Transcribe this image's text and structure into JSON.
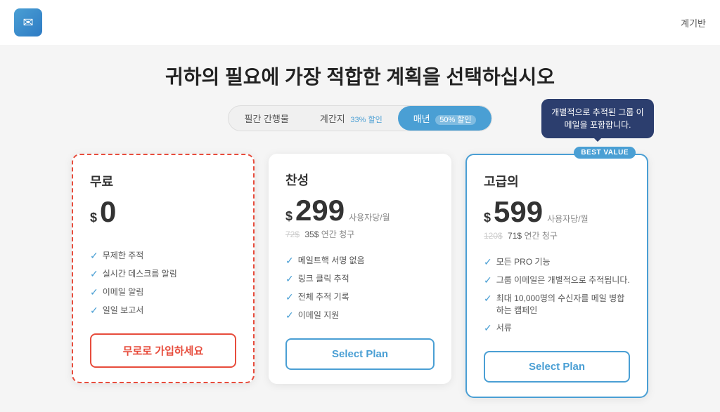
{
  "header": {
    "nav_label": "계기반",
    "logo_icon": "✉"
  },
  "page": {
    "title": "귀하의 필요에 가장 적합한 계획을 선택하십시오"
  },
  "billing": {
    "options": [
      {
        "id": "monthly",
        "label": "필간 간행물",
        "active": false
      },
      {
        "id": "quarterly",
        "label": "계간지",
        "discount": "33% 할인",
        "active": false
      },
      {
        "id": "annual",
        "label": "매년",
        "discount": "50% 할인",
        "active": true
      }
    ]
  },
  "tooltip": {
    "text": "개별적으로 추적된 그룹 이메일을 포함합니다."
  },
  "plans": [
    {
      "id": "free",
      "name": "무료",
      "currency": "$",
      "price": "0",
      "per_unit": "",
      "annual_original": "",
      "annual_discounted": "",
      "annual_label": "",
      "features": [
        "무제한 주적",
        "실시간 데스크름 알림",
        "이메일 알림",
        "일일 보고서"
      ],
      "button_label": "무로로 가입하세요",
      "button_style": "outline-red",
      "best_value": false,
      "card_style": "free"
    },
    {
      "id": "pro",
      "name": "찬성",
      "currency": "$",
      "price": "299",
      "per_unit": "사용자당/월",
      "annual_original": "72$",
      "annual_discounted": "35$",
      "annual_label": "연간 청구",
      "features": [
        "메일트핵 서명 없음",
        "링크 클릭 추적",
        "전체 추적 기록",
        "이메일 지원"
      ],
      "button_label": "Select Plan",
      "button_style": "outline-blue",
      "best_value": false,
      "card_style": "pro"
    },
    {
      "id": "premium",
      "name": "고급의",
      "currency": "$",
      "price": "599",
      "per_unit": "사용자당/월",
      "annual_original": "120$",
      "annual_discounted": "71$",
      "annual_label": "연간 청구",
      "features": [
        "모든 PRO 기능",
        "그룹 이메일은 개별적으로 추적됩니다.",
        "최대 10,000명의 수신자를 메일 병합하는 캠페인",
        "서류"
      ],
      "button_label": "Select Plan",
      "button_style": "outline-blue",
      "best_value": true,
      "best_value_label": "BEST VALUE",
      "card_style": "premium"
    }
  ]
}
